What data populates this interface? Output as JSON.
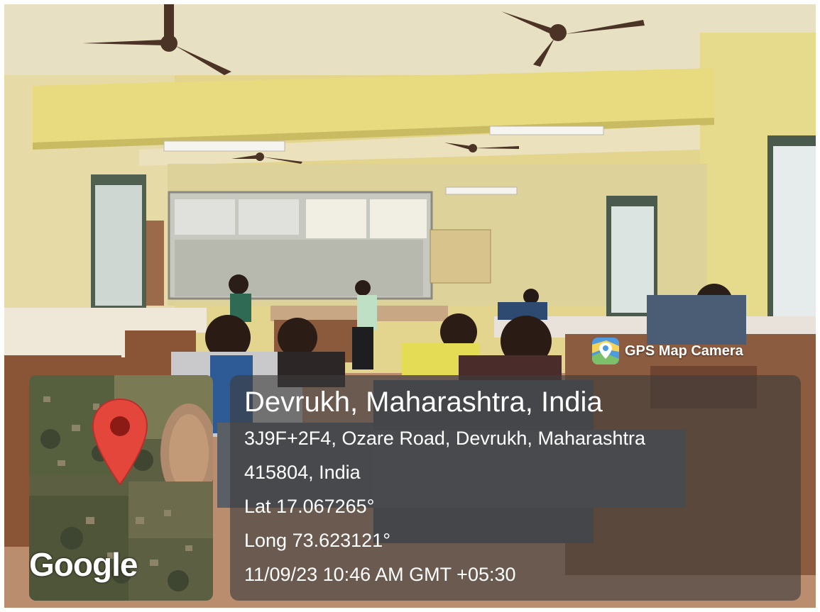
{
  "badge": {
    "label": "GPS Map Camera",
    "icon": "map-pin-badge-icon"
  },
  "map": {
    "provider_label": "Google",
    "marker_icon": "map-marker-icon",
    "marker_color": "#e5463c"
  },
  "location": {
    "title": "Devrukh, Maharashtra, India",
    "address_line_1": "3J9F+2F4, Ozare Road, Devrukh, Maharashtra",
    "address_line_2": "415804, India",
    "latitude": "Lat 17.067265°",
    "longitude": "Long 73.623121°",
    "datetime": "11/09/23 10:46 AM GMT +05:30"
  }
}
